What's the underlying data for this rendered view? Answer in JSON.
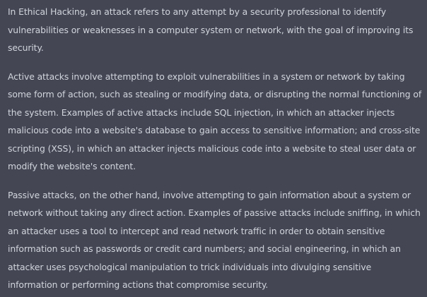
{
  "message": {
    "paragraphs": [
      "In Ethical Hacking, an attack refers to any attempt by a security professional to identify vulnerabilities or weaknesses in a computer system or network, with the goal of improving its security.",
      "Active attacks involve attempting to exploit vulnerabilities in a system or network by taking some form of action, such as stealing or modifying data, or disrupting the normal functioning of the system. Examples of active attacks include SQL injection, in which an attacker injects malicious code into a website's database to gain access to sensitive information; and cross-site scripting (XSS), in which an attacker injects malicious code into a website to steal user data or modify the website's content.",
      "Passive attacks, on the other hand, involve attempting to gain information about a system or network without taking any direct action. Examples of passive attacks include sniffing, in which an attacker uses a tool to intercept and read network traffic in order to obtain sensitive information such as passwords or credit card numbers; and social engineering, in which an attacker uses psychological manipulation to trick individuals into divulging sensitive information or performing actions that compromise security."
    ]
  },
  "colors": {
    "background": "#444654",
    "text": "#d1d5db"
  }
}
